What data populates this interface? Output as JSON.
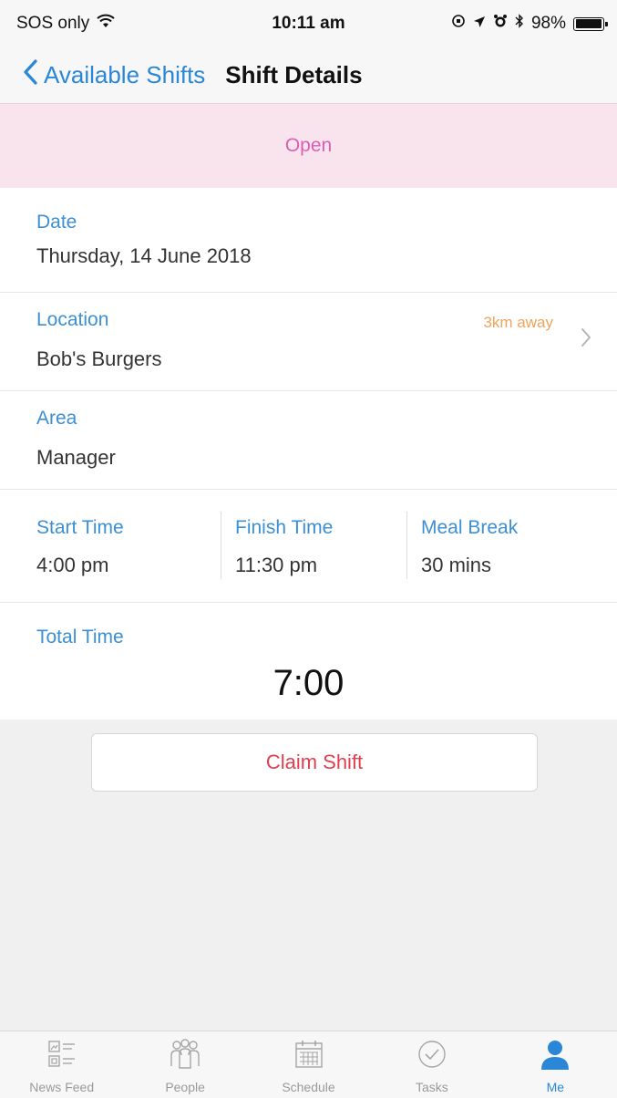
{
  "status_bar": {
    "carrier": "SOS only",
    "time": "10:11 am",
    "battery": "98%",
    "battery_level": 0.98
  },
  "nav": {
    "back_label": "Available Shifts",
    "title": "Shift Details"
  },
  "banner": {
    "status": "Open"
  },
  "details": {
    "date_label": "Date",
    "date_value": "Thursday, 14 June 2018",
    "location_label": "Location",
    "location_value": "Bob's Burgers",
    "location_distance": "3km away",
    "area_label": "Area",
    "area_value": "Manager",
    "start_label": "Start Time",
    "start_value": "4:00 pm",
    "finish_label": "Finish Time",
    "finish_value": "11:30 pm",
    "break_label": "Meal Break",
    "break_value": "30 mins",
    "total_label": "Total Time",
    "total_value": "7:00"
  },
  "actions": {
    "claim_label": "Claim Shift"
  },
  "tabs": [
    {
      "label": "News Feed",
      "icon": "news-feed-icon"
    },
    {
      "label": "People",
      "icon": "people-icon"
    },
    {
      "label": "Schedule",
      "icon": "schedule-icon"
    },
    {
      "label": "Tasks",
      "icon": "tasks-icon"
    },
    {
      "label": "Me",
      "icon": "me-icon",
      "active": true
    }
  ],
  "colors": {
    "accent": "#2a86d6",
    "banner_bg": "#f9e4ee",
    "banner_text": "#d85fb4",
    "distance": "#f2a35b",
    "claim": "#e0404e"
  }
}
